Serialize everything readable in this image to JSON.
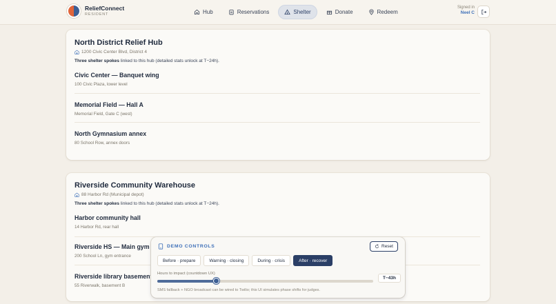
{
  "header": {
    "brand_name": "ReliefConnect",
    "brand_role": "RESIDENT",
    "nav": [
      {
        "label": "Hub",
        "icon": "home-icon"
      },
      {
        "label": "Reservations",
        "icon": "clipboard-icon"
      },
      {
        "label": "Shelter",
        "icon": "tent-icon",
        "active": true
      },
      {
        "label": "Donate",
        "icon": "gift-icon"
      },
      {
        "label": "Redeem",
        "icon": "map-pin-icon"
      }
    ],
    "signed_in_label": "Signed in",
    "user_name": "Neel C"
  },
  "hubs": [
    {
      "name": "North District Relief Hub",
      "address": "1200 Civic Center Blvd, District 4",
      "note_bold": "Three shelter spokes",
      "note_rest": " linked to this hub (detailed stats unlock at T−24h).",
      "spokes": [
        {
          "name": "Civic Center — Banquet wing",
          "location": "100 Civic Plaza, lower level"
        },
        {
          "name": "Memorial Field — Hall A",
          "location": "Memorial Field, Gate C (west)"
        },
        {
          "name": "North Gymnasium annex",
          "location": "80 School Row, annex doors"
        }
      ]
    },
    {
      "name": "Riverside Community Warehouse",
      "address": "88 Harbor Rd (Municipal depot)",
      "note_bold": "Three shelter spokes",
      "note_rest": " linked to this hub (detailed stats unlock at T−24h).",
      "spokes": [
        {
          "name": "Harbor community hall",
          "location": "14 Harbor Rd, rear hall"
        },
        {
          "name": "Riverside HS — Main gym",
          "location": "200 School Ln, gym entrance"
        },
        {
          "name": "Riverside library basement",
          "location": "55 Riverwalk, basement B"
        }
      ]
    }
  ],
  "demo": {
    "title": "DEMO CONTROLS",
    "reset_label": "Reset",
    "phases": [
      {
        "label": "Before · prepare"
      },
      {
        "label": "Warning · closing"
      },
      {
        "label": "During · crisis"
      },
      {
        "label": "After · recover",
        "active": true
      }
    ],
    "slider_label": "Hours to impact (countdown UX)",
    "slider_fraction": 0.27,
    "countdown_value": "T−43h",
    "footnote": "SMS fallback + NGO broadcast can be wired to Twilio; this UI simulates phase shifts for judges."
  },
  "colors": {
    "accent": "#2b3f66",
    "link": "#3d6fb8",
    "background": "#f3efe8"
  }
}
